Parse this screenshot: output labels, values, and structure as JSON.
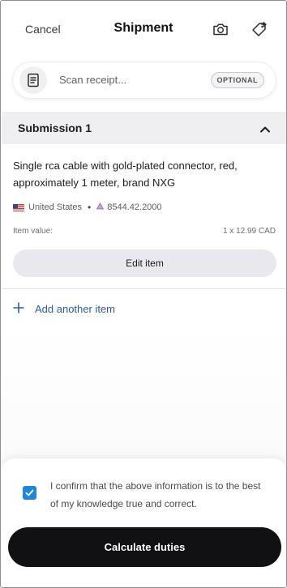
{
  "header": {
    "cancel_label": "Cancel",
    "title": "Shipment",
    "camera_icon": "camera-icon",
    "add_tag_icon": "tag-plus-icon"
  },
  "scan": {
    "icon": "receipt-icon",
    "label": "Scan receipt...",
    "badge": "OPTIONAL"
  },
  "submission": {
    "title": "Submission 1",
    "toggle_icon": "chevron-up-icon",
    "item": {
      "description": "Single rca cable with gold-plated connector, red, approximately 1 meter, brand NXG",
      "country_flag_icon": "us-flag-icon",
      "country": "United States",
      "separator": "•",
      "hs_icon": "tariff-code-icon",
      "hs_code": "8544.42.2000",
      "value_label": "Item value:",
      "value_amount": "1 x 12.99 CAD",
      "edit_label": "Edit item"
    }
  },
  "add_item": {
    "icon": "plus-icon",
    "label": "Add another item"
  },
  "footer": {
    "confirm_checked": true,
    "confirm_text": "I confirm that the above information is to the best of my knowledge true and correct.",
    "calculate_label": "Calculate duties"
  },
  "colors": {
    "accent_blue": "#2a5db0",
    "checkbox_blue": "#1f86e0",
    "primary_button": "#111114"
  }
}
